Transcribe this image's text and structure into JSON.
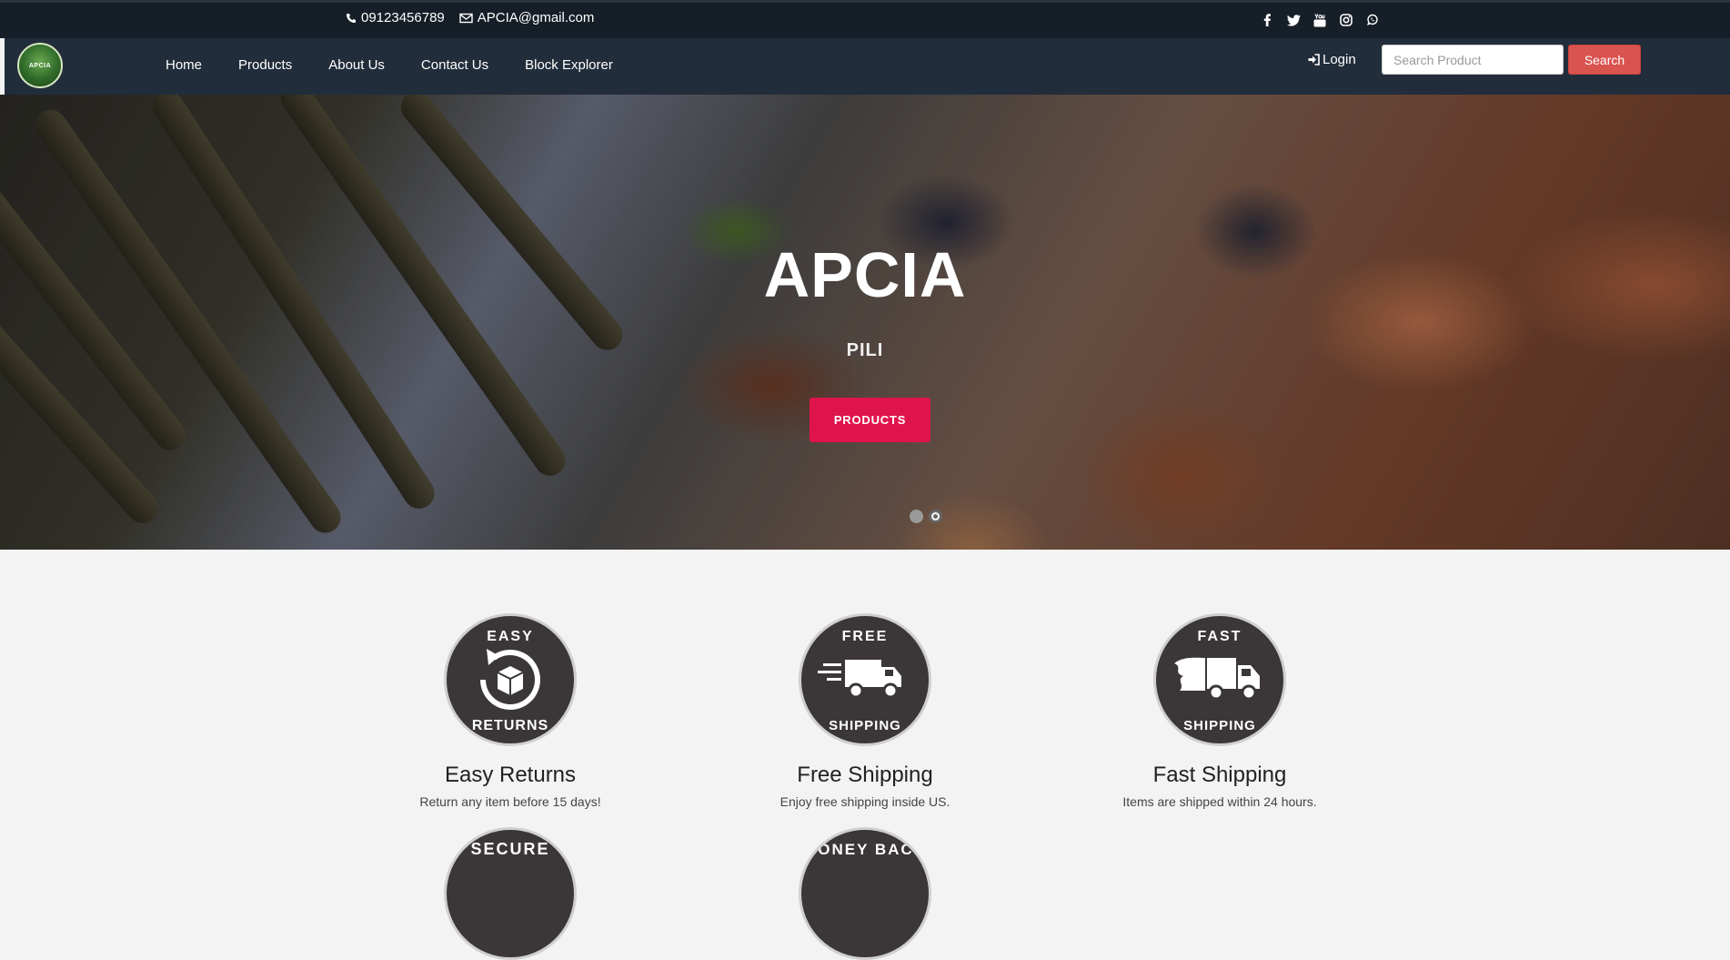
{
  "topbar": {
    "phone": "09123456789",
    "email": "APCIA@gmail.com",
    "social_icons": [
      "facebook-icon",
      "twitter-icon",
      "youtube-icon",
      "instagram-icon",
      "whatsapp-icon"
    ]
  },
  "navbar": {
    "logo_text": "APCIA",
    "links": [
      "Home",
      "Products",
      "About Us",
      "Contact Us",
      "Block Explorer"
    ],
    "login_label": "Login",
    "search_placeholder": "Search Product",
    "search_button": "Search"
  },
  "hero": {
    "title": "APCIA",
    "subtitle": "PILI",
    "button_label": "PRODUCTS",
    "slides": 2,
    "active_slide": 2
  },
  "features": [
    {
      "badge_top": "EASY",
      "badge_bottom": "RETURNS",
      "title": "Easy Returns",
      "desc": "Return any item before 15 days!"
    },
    {
      "badge_top": "FREE",
      "badge_bottom": "SHIPPING",
      "title": "Free Shipping",
      "desc": "Enjoy free shipping inside US."
    },
    {
      "badge_top": "FAST",
      "badge_bottom": "SHIPPING",
      "title": "Fast Shipping",
      "desc": "Items are shipped within 24 hours."
    },
    {
      "badge_top": "SECURE",
      "badge_bottom": "",
      "title": "",
      "desc": ""
    },
    {
      "badge_top": "MONEY BACK",
      "badge_bottom": "",
      "title": "",
      "desc": ""
    }
  ],
  "colors": {
    "topbar_bg": "#161e27",
    "navbar_bg": "#222d3b",
    "search_button": "#d9534f",
    "hero_button": "#e0144c",
    "badge_bg": "#3b3637"
  }
}
